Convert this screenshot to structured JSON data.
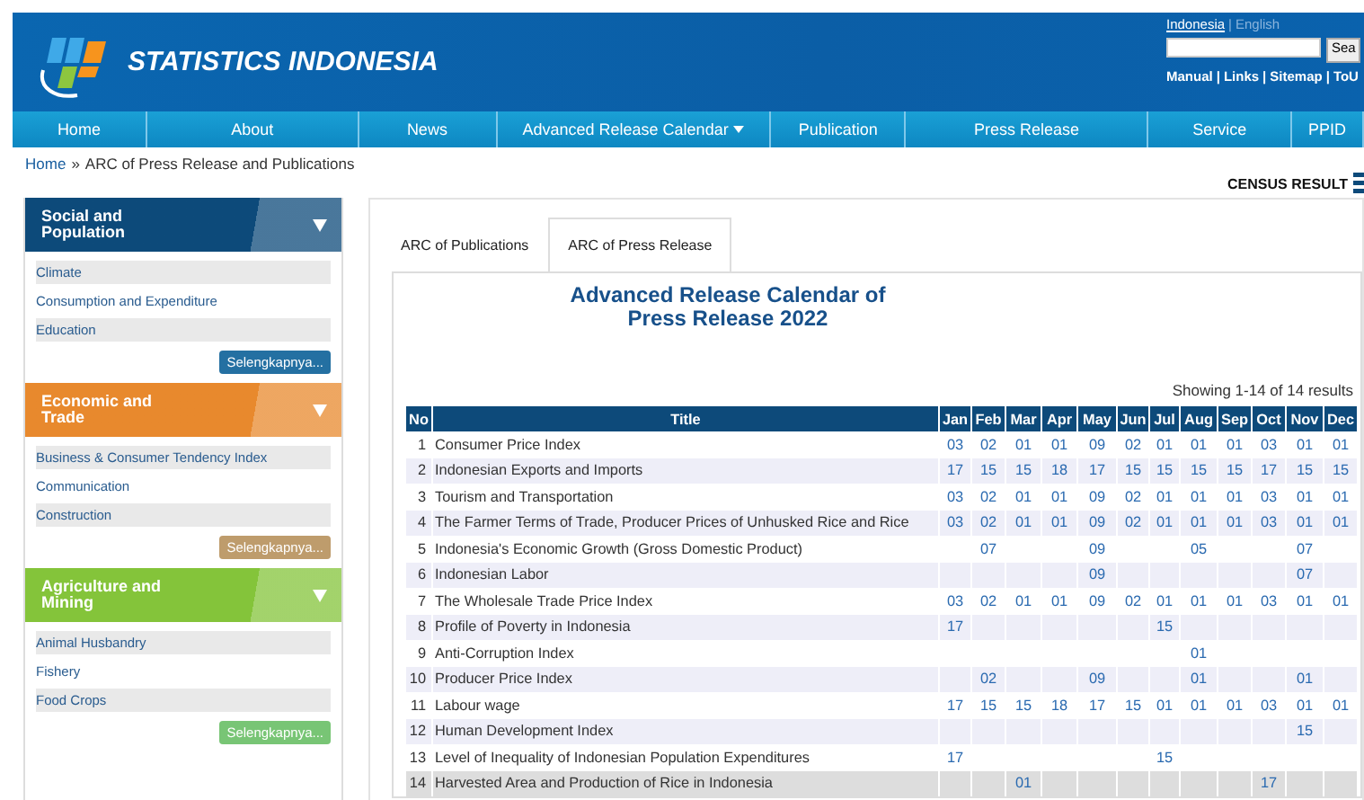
{
  "header": {
    "site_name": "STATISTICS INDONESIA",
    "languages": [
      {
        "label": "Indonesia",
        "selected": true
      },
      {
        "label": "English",
        "selected": false
      }
    ],
    "language_separator": "|",
    "search_button": "Sea",
    "links": [
      "Manual",
      "Links",
      "Sitemap",
      "ToU"
    ],
    "link_separator": "|"
  },
  "nav": [
    {
      "label": "Home",
      "dropdown": false
    },
    {
      "label": "About",
      "dropdown": false
    },
    {
      "label": "News",
      "dropdown": false
    },
    {
      "label": "Advanced Release Calendar",
      "dropdown": true
    },
    {
      "label": "Publication",
      "dropdown": false
    },
    {
      "label": "Press Release",
      "dropdown": false
    },
    {
      "label": "Service",
      "dropdown": false
    },
    {
      "label": "PPID",
      "dropdown": false
    }
  ],
  "breadcrumb": {
    "home": "Home",
    "separator": "»",
    "current": "ARC of Press Release and Publications"
  },
  "census_result": "CENSUS RESULT",
  "sidebar": [
    {
      "title": "Social and Population",
      "color": "#0d4a7a",
      "items": [
        "Climate",
        "Consumption and Expenditure",
        "Education"
      ],
      "more": "Selengkapnya..."
    },
    {
      "title": "Economic and Trade",
      "color": "#e8892d",
      "items": [
        "Business & Consumer Tendency Index",
        "Communication",
        "Construction"
      ],
      "more": "Selengkapnya..."
    },
    {
      "title": "Agriculture and Mining",
      "color": "#84c43a",
      "items": [
        "Animal Husbandry",
        "Fishery",
        "Food Crops"
      ],
      "more": "Selengkapnya..."
    }
  ],
  "tabs": [
    {
      "label": "ARC of Publications",
      "selected": false
    },
    {
      "label": "ARC of Press Release",
      "selected": true
    }
  ],
  "calendar": {
    "title": [
      "Advanced Release Calendar of",
      "Press Release 2022"
    ],
    "showing": "Showing 1-14 of 14 results",
    "columns": [
      "No",
      "Title",
      "Jan",
      "Feb",
      "Mar",
      "Apr",
      "May",
      "Jun",
      "Jul",
      "Aug",
      "Sep",
      "Oct",
      "Nov",
      "Dec"
    ],
    "rows": [
      {
        "no": "1",
        "title": "Consumer Price Index",
        "dates": {
          "jan": "03",
          "feb": "02",
          "mar": "01",
          "apr": "01",
          "may": "09",
          "jun": "02",
          "jul": "01",
          "aug": "01",
          "sep": "01",
          "oct": "03",
          "nov": "01",
          "dec": "01"
        },
        "selected": false
      },
      {
        "no": "2",
        "title": "Indonesian Exports and Imports",
        "dates": {
          "jan": "17",
          "feb": "15",
          "mar": "15",
          "apr": "18",
          "may": "17",
          "jun": "15",
          "jul": "15",
          "aug": "15",
          "sep": "15",
          "oct": "17",
          "nov": "15",
          "dec": "15"
        },
        "selected": false
      },
      {
        "no": "3",
        "title": "Tourism and Transportation",
        "dates": {
          "jan": "03",
          "feb": "02",
          "mar": "01",
          "apr": "01",
          "may": "09",
          "jun": "02",
          "jul": "01",
          "aug": "01",
          "sep": "01",
          "oct": "03",
          "nov": "01",
          "dec": "01"
        },
        "selected": false
      },
      {
        "no": "4",
        "title": "The Farmer Terms of Trade, Producer Prices of Unhusked Rice and Rice",
        "dates": {
          "jan": "03",
          "feb": "02",
          "mar": "01",
          "apr": "01",
          "may": "09",
          "jun": "02",
          "jul": "01",
          "aug": "01",
          "sep": "01",
          "oct": "03",
          "nov": "01",
          "dec": "01"
        },
        "selected": false
      },
      {
        "no": "5",
        "title": "Indonesia's Economic Growth (Gross Domestic Product)",
        "dates": {
          "feb": "07",
          "may": "09",
          "aug": "05",
          "nov": "07"
        },
        "selected": false
      },
      {
        "no": "6",
        "title": "Indonesian Labor",
        "dates": {
          "may": "09",
          "nov": "07"
        },
        "selected": false
      },
      {
        "no": "7",
        "title": "The Wholesale Trade Price Index",
        "dates": {
          "jan": "03",
          "feb": "02",
          "mar": "01",
          "apr": "01",
          "may": "09",
          "jun": "02",
          "jul": "01",
          "aug": "01",
          "sep": "01",
          "oct": "03",
          "nov": "01",
          "dec": "01"
        },
        "selected": false
      },
      {
        "no": "8",
        "title": "Profile of Poverty in Indonesia",
        "dates": {
          "jan": "17",
          "jul": "15"
        },
        "selected": false
      },
      {
        "no": "9",
        "title": "Anti-Corruption Index",
        "dates": {
          "aug": "01"
        },
        "selected": false
      },
      {
        "no": "10",
        "title": "Producer Price Index",
        "dates": {
          "feb": "02",
          "may": "09",
          "aug": "01",
          "nov": "01"
        },
        "selected": false
      },
      {
        "no": "11",
        "title": "Labour wage",
        "dates": {
          "jan": "17",
          "feb": "15",
          "mar": "15",
          "apr": "18",
          "may": "17",
          "jun": "15",
          "jul": "01",
          "aug": "01",
          "sep": "01",
          "oct": "03",
          "nov": "01",
          "dec": "01"
        },
        "selected": false
      },
      {
        "no": "12",
        "title": "Human Development Index",
        "dates": {
          "nov": "15"
        },
        "selected": false
      },
      {
        "no": "13",
        "title": "Level of Inequality of Indonesian Population Expenditures",
        "dates": {
          "jan": "17",
          "jul": "15"
        },
        "selected": false
      },
      {
        "no": "14",
        "title": "Harvested Area and Production of Rice in Indonesia",
        "dates": {
          "mar": "01",
          "oct": "17"
        },
        "selected": true
      }
    ]
  }
}
